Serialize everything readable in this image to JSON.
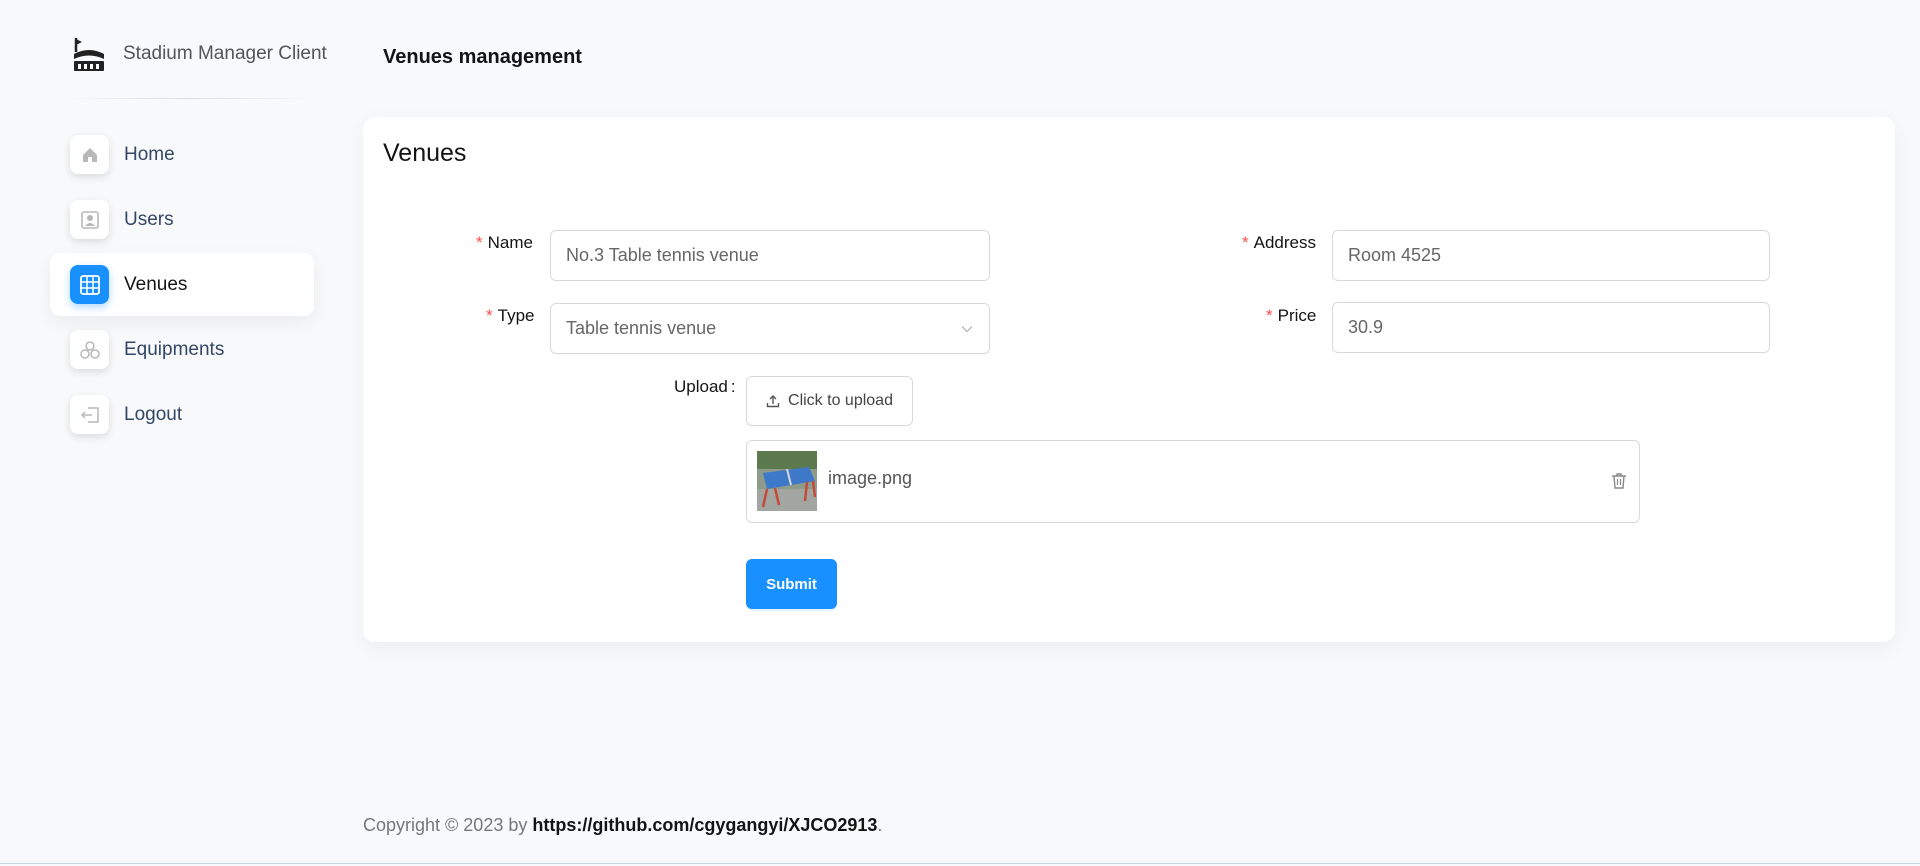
{
  "brand": {
    "name": "Stadium Manager Client"
  },
  "sidebar": {
    "items": [
      {
        "label": "Home",
        "icon": "home-icon"
      },
      {
        "label": "Users",
        "icon": "user-icon"
      },
      {
        "label": "Venues",
        "icon": "table-icon",
        "active": true
      },
      {
        "label": "Equipments",
        "icon": "equipments-icon"
      },
      {
        "label": "Logout",
        "icon": "logout-icon"
      }
    ]
  },
  "header": {
    "title": "Venues management"
  },
  "card": {
    "title": "Venues",
    "form": {
      "name": {
        "label": "Name",
        "value": "No.3 Table tennis venue"
      },
      "address": {
        "label": "Address",
        "value": "Room 4525"
      },
      "type": {
        "label": "Type",
        "value": "Table tennis venue"
      },
      "price": {
        "label": "Price",
        "value": "30.9"
      },
      "upload": {
        "label": "Upload",
        "colon": ":",
        "button_label": "Click to upload",
        "file_name": "image.png"
      },
      "submit_label": "Submit"
    }
  },
  "footer": {
    "prefix": "Copyright © 2023 by ",
    "link": "https://github.com/cgygangyi/XJCO2913",
    "suffix": "."
  },
  "colors": {
    "primary": "#1890ff",
    "required": "#ff4d4f"
  }
}
